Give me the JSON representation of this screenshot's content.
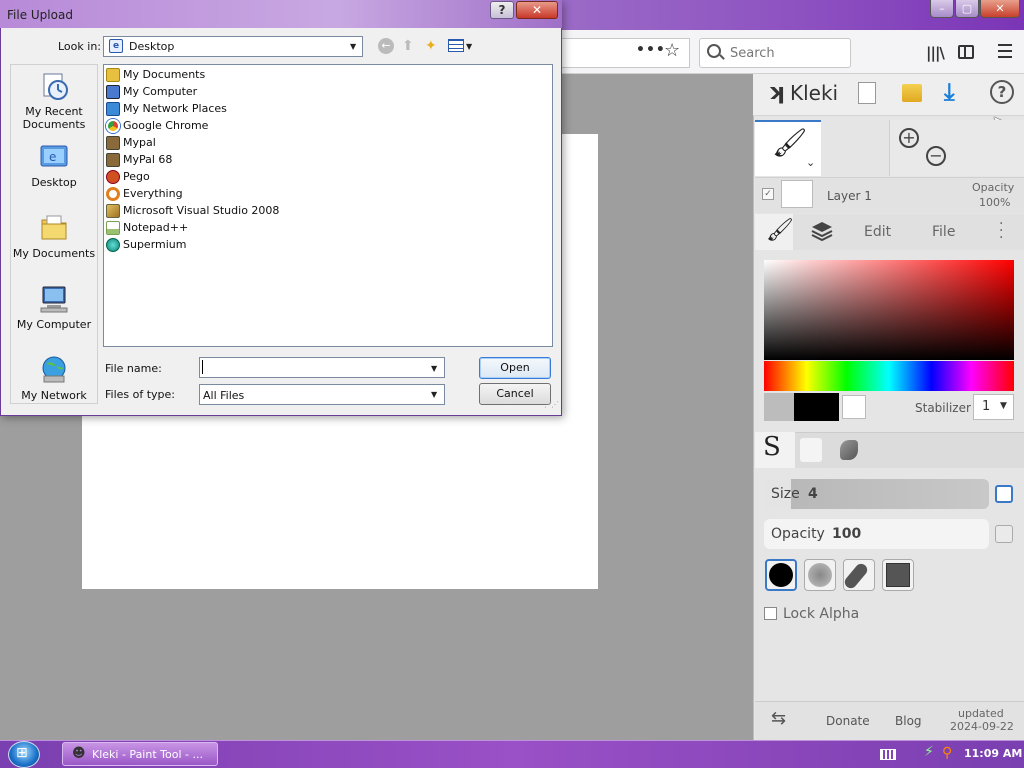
{
  "browser": {
    "search_placeholder": "Search",
    "page_actions_glyph": "•••",
    "bookmark_glyph": "☆",
    "library_glyph": "|||\\"
  },
  "kleki": {
    "logo": "Kleki",
    "help_glyph": "?",
    "layer": {
      "name": "Layer 1",
      "opacity_label": "Opacity",
      "opacity_value": "100%"
    },
    "tabs": {
      "edit": "Edit",
      "file": "File"
    },
    "stabilizer_label": "Stabilizer",
    "stabilizer_value": "1",
    "size_label": "Size",
    "size_value": "4",
    "opacity_label": "Opacity",
    "opacity_value": "100",
    "lock_alpha_label": "Lock Alpha",
    "footer": {
      "donate": "Donate",
      "blog": "Blog",
      "updated_label": "updated",
      "updated_date": "2024-09-22"
    },
    "colors": {
      "primary": "#000000",
      "secondary": "#ffffff",
      "accent": "#3a79c8"
    }
  },
  "dialog": {
    "title": "File Upload",
    "help_glyph": "?",
    "close_glyph": "✕",
    "look_in_label": "Look in:",
    "look_in_value": "Desktop",
    "places": [
      {
        "label": "My Recent Documents",
        "icon": "recent-documents-icon"
      },
      {
        "label": "Desktop",
        "icon": "desktop-icon"
      },
      {
        "label": "My Documents",
        "icon": "my-documents-icon"
      },
      {
        "label": "My Computer",
        "icon": "my-computer-icon"
      },
      {
        "label": "My Network",
        "icon": "my-network-icon"
      }
    ],
    "files": [
      {
        "name": "My Documents",
        "icon": "folder-icon",
        "color": "#e8c040"
      },
      {
        "name": "My Computer",
        "icon": "computer-icon",
        "color": "#4a7ad0"
      },
      {
        "name": "My Network Places",
        "icon": "network-icon",
        "color": "#3a8ad8"
      },
      {
        "name": "Google Chrome",
        "icon": "chrome-icon",
        "color": "#e04030"
      },
      {
        "name": "Mypal",
        "icon": "shortcut-icon",
        "color": "#8a6a3a"
      },
      {
        "name": "MyPal 68",
        "icon": "shortcut-icon",
        "color": "#8a6a3a"
      },
      {
        "name": "Pego",
        "icon": "pego-icon",
        "color": "#d05020"
      },
      {
        "name": "Everything",
        "icon": "everything-icon",
        "color": "#e08020"
      },
      {
        "name": "Microsoft Visual Studio 2008",
        "icon": "visual-studio-icon",
        "color": "#c0a040"
      },
      {
        "name": "Notepad++",
        "icon": "notepad-icon",
        "color": "#7aa050"
      },
      {
        "name": "Supermium",
        "icon": "supermium-icon",
        "color": "#20a0a0"
      }
    ],
    "file_name_label": "File name:",
    "file_name_value": "",
    "files_of_type_label": "Files of type:",
    "files_of_type_value": "All Files",
    "open_label": "Open",
    "cancel_label": "Cancel"
  },
  "taskbar": {
    "task_label": "Kleki - Paint Tool - ...",
    "clock": "11:09 AM"
  }
}
